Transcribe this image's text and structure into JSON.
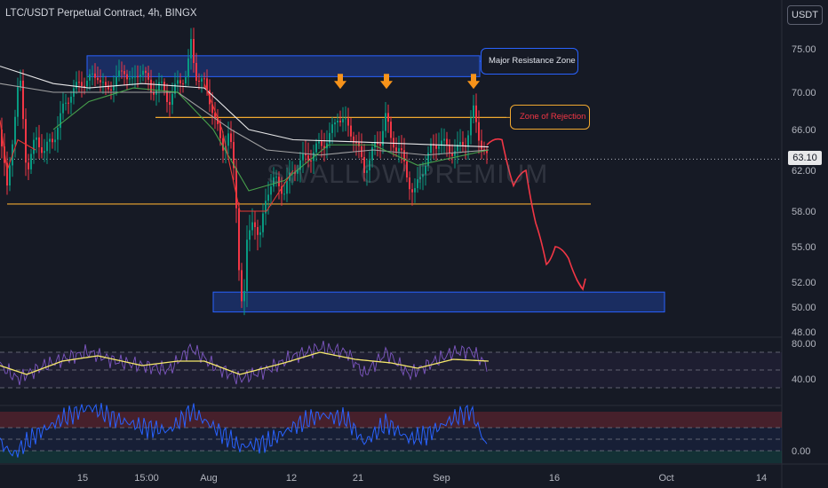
{
  "header": {
    "title": "LTC/USDT Perpetual Contract, 4h, BINGX",
    "currency": "USDT"
  },
  "watermark": "SWALLOW PREMIUM",
  "current_price": "63.10",
  "annotations": {
    "resistance_label": "Major Resistance Zone",
    "rejection_label": "Zone of Rejection"
  },
  "colors": {
    "background": "#161a25",
    "up": "#089981",
    "down": "#f23645",
    "zone": "#2962ff",
    "rejection_line": "#f0a830",
    "arrow": "#f7931a",
    "projection": "#f23645",
    "ma_white": "#ffffff",
    "ma_green": "#4caf50",
    "ma_red": "#e53935",
    "rsi": "#7e57c2",
    "rsi_signal": "#f5e76a",
    "osc": "#2962ff"
  },
  "icons": {
    "marker": "arrow-down-icon"
  },
  "chart_data": [
    {
      "type": "candlestick",
      "title": "LTC/USDT Perpetual Contract, 4h, BINGX",
      "x_ticks": [
        "15",
        "15:00",
        "Aug",
        "12",
        "21",
        "Sep",
        "16",
        "Oct",
        "14"
      ],
      "y_ticks": [
        48,
        50,
        52,
        55,
        58,
        62,
        66,
        70,
        75
      ],
      "y_tick_labels": [
        "48.00",
        "50.00",
        "52.00",
        "55.00",
        "58.00",
        "62.00",
        "66.00",
        "70.00",
        "75.00"
      ],
      "last_price": 63.1,
      "price_path": [
        [
          0,
          66
        ],
        [
          8,
          60
        ],
        [
          15,
          66
        ],
        [
          22,
          72
        ],
        [
          30,
          62
        ],
        [
          40,
          65
        ],
        [
          50,
          64
        ],
        [
          60,
          65
        ],
        [
          70,
          68
        ],
        [
          80,
          70
        ],
        [
          90,
          71
        ],
        [
          100,
          71.5
        ],
        [
          110,
          72
        ],
        [
          120,
          70
        ],
        [
          130,
          71.5
        ],
        [
          140,
          72.5
        ],
        [
          150,
          71
        ],
        [
          160,
          73
        ],
        [
          170,
          70
        ],
        [
          180,
          71
        ],
        [
          190,
          69
        ],
        [
          200,
          71
        ],
        [
          210,
          72
        ],
        [
          215,
          75.6
        ],
        [
          220,
          72
        ],
        [
          230,
          71
        ],
        [
          240,
          68
        ],
        [
          250,
          64
        ],
        [
          258,
          66
        ],
        [
          265,
          60
        ],
        [
          270,
          52
        ],
        [
          274,
          49.6
        ],
        [
          278,
          55
        ],
        [
          285,
          58
        ],
        [
          292,
          55
        ],
        [
          300,
          60
        ],
        [
          310,
          61
        ],
        [
          320,
          60
        ],
        [
          330,
          62
        ],
        [
          340,
          63
        ],
        [
          350,
          63.5
        ],
        [
          360,
          64.5
        ],
        [
          370,
          65
        ],
        [
          380,
          67.5
        ],
        [
          390,
          66.5
        ],
        [
          400,
          65
        ],
        [
          410,
          62
        ],
        [
          420,
          64
        ],
        [
          428,
          65
        ],
        [
          434,
          67.5
        ],
        [
          440,
          65
        ],
        [
          450,
          64
        ],
        [
          460,
          61
        ],
        [
          466,
          59.5
        ],
        [
          475,
          62
        ],
        [
          485,
          64
        ],
        [
          495,
          65
        ],
        [
          505,
          64
        ],
        [
          515,
          64
        ],
        [
          525,
          65
        ],
        [
          533,
          68
        ],
        [
          540,
          65
        ],
        [
          548,
          63.1
        ]
      ],
      "moving_averages": [
        {
          "name": "",
          "values": [
            [
              0,
              73
            ],
            [
              60,
              71
            ],
            [
              100,
              70.5
            ],
            [
              160,
              71
            ],
            [
              230,
              70.5
            ],
            [
              280,
              66
            ],
            [
              330,
              65
            ],
            [
              400,
              64.8
            ],
            [
              460,
              64.6
            ],
            [
              550,
              64.3
            ]
          ]
        },
        {
          "name": "",
          "values": [
            [
              0,
              71
            ],
            [
              60,
              70
            ],
            [
              120,
              70
            ],
            [
              200,
              70
            ],
            [
              260,
              66
            ],
            [
              300,
              64
            ],
            [
              360,
              63.5
            ],
            [
              420,
              64
            ],
            [
              480,
              63.5
            ],
            [
              550,
              64
            ]
          ]
        },
        {
          "name": "",
          "values": [
            [
              60,
              66
            ],
            [
              100,
              69
            ],
            [
              150,
              70.5
            ],
            [
              200,
              70
            ],
            [
              240,
              66
            ],
            [
              280,
              60
            ],
            [
              320,
              61
            ],
            [
              370,
              64.5
            ],
            [
              420,
              64.5
            ],
            [
              470,
              62.5
            ],
            [
              550,
              64
            ]
          ]
        }
      ],
      "levels": [
        {
          "kind": "resistance_zone",
          "from": 71.8,
          "to": 74.2,
          "x_start": 98,
          "x_end": 540
        },
        {
          "kind": "rejection_line",
          "value": 67.3,
          "x_start": 175,
          "x_end": 570
        },
        {
          "kind": "support_line",
          "value": 58.7,
          "x_start": 8,
          "x_end": 665
        },
        {
          "kind": "target_zone",
          "from": 49.6,
          "to": 51.2,
          "x_start": 240,
          "x_end": 748
        }
      ],
      "rejection_markers_x": [
        383,
        435,
        533
      ],
      "projection_path": [
        [
          548,
          64.5
        ],
        [
          565,
          65
        ],
        [
          578,
          60.5
        ],
        [
          592,
          62
        ],
        [
          603,
          57
        ],
        [
          615,
          53.5
        ],
        [
          625,
          55
        ],
        [
          640,
          54
        ],
        [
          655,
          51.5
        ]
      ]
    },
    {
      "type": "line",
      "title": "",
      "y_ticks": [
        40,
        80
      ],
      "y_tick_labels": [
        "40.00",
        "80.00"
      ],
      "series": [
        {
          "name": "",
          "values": [
            [
              0,
              55
            ],
            [
              20,
              40
            ],
            [
              50,
              55
            ],
            [
              80,
              65
            ],
            [
              100,
              70
            ],
            [
              130,
              60
            ],
            [
              160,
              55
            ],
            [
              190,
              50
            ],
            [
              215,
              75
            ],
            [
              240,
              55
            ],
            [
              270,
              40
            ],
            [
              300,
              50
            ],
            [
              330,
              65
            ],
            [
              360,
              75
            ],
            [
              390,
              70
            ],
            [
              410,
              45
            ],
            [
              435,
              70
            ],
            [
              460,
              45
            ],
            [
              480,
              55
            ],
            [
              510,
              70
            ],
            [
              530,
              72
            ],
            [
              548,
              55
            ]
          ]
        },
        {
          "name": "",
          "values": [
            [
              0,
              55
            ],
            [
              30,
              45
            ],
            [
              70,
              60
            ],
            [
              110,
              66
            ],
            [
              160,
              55
            ],
            [
              200,
              60
            ],
            [
              230,
              60
            ],
            [
              270,
              45
            ],
            [
              320,
              58
            ],
            [
              360,
              70
            ],
            [
              400,
              62
            ],
            [
              440,
              58
            ],
            [
              470,
              52
            ],
            [
              510,
              62
            ],
            [
              550,
              60
            ]
          ]
        }
      ]
    },
    {
      "type": "line",
      "title": "",
      "y_ticks": [
        0
      ],
      "y_tick_labels": [
        "0.00"
      ],
      "series": [
        {
          "name": "",
          "values": [
            [
              0,
              10
            ],
            [
              15,
              -5
            ],
            [
              40,
              20
            ],
            [
              70,
              40
            ],
            [
              100,
              55
            ],
            [
              130,
              40
            ],
            [
              160,
              30
            ],
            [
              190,
              25
            ],
            [
              215,
              50
            ],
            [
              240,
              30
            ],
            [
              270,
              5
            ],
            [
              300,
              10
            ],
            [
              330,
              30
            ],
            [
              360,
              45
            ],
            [
              390,
              40
            ],
            [
              410,
              10
            ],
            [
              435,
              35
            ],
            [
              460,
              15
            ],
            [
              480,
              20
            ],
            [
              510,
              40
            ],
            [
              530,
              50
            ],
            [
              548,
              5
            ]
          ]
        }
      ]
    }
  ]
}
